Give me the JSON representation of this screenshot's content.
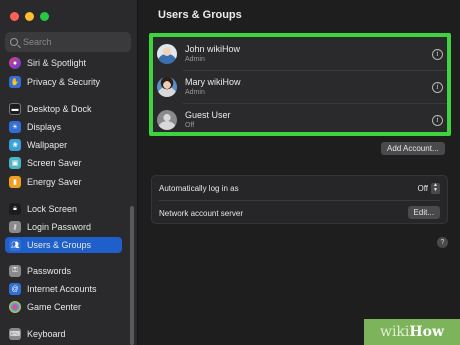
{
  "window": {
    "traffic_colors": [
      "#ff5f57",
      "#febc2e",
      "#28c840"
    ]
  },
  "search": {
    "placeholder": "Search"
  },
  "sidebar": {
    "items": [
      {
        "label": "Siri & Spotlight",
        "icon": "siri-icon",
        "color": "#8e44ad"
      },
      {
        "label": "Privacy & Security",
        "icon": "hand-icon",
        "color": "#2f6fd6"
      },
      {
        "label": "Desktop & Dock",
        "icon": "dock-icon",
        "color": "#1c1c1e"
      },
      {
        "label": "Displays",
        "icon": "sun-icon",
        "color": "#2f6fd6"
      },
      {
        "label": "Wallpaper",
        "icon": "wallpaper-icon",
        "color": "#3aa0d8"
      },
      {
        "label": "Screen Saver",
        "icon": "screen-saver-icon",
        "color": "#4cb6c9"
      },
      {
        "label": "Energy Saver",
        "icon": "battery-icon",
        "color": "#f0a020"
      },
      {
        "label": "Lock Screen",
        "icon": "lock-icon",
        "color": "#1c1c1e"
      },
      {
        "label": "Login Password",
        "icon": "key-icon",
        "color": "#8a8a8c"
      },
      {
        "label": "Users & Groups",
        "icon": "users-icon",
        "color": "#2f6fd6",
        "active": true
      },
      {
        "label": "Passwords",
        "icon": "passwords-icon",
        "color": "#8a8a8c"
      },
      {
        "label": "Internet Accounts",
        "icon": "at-icon",
        "color": "#2f6fd6"
      },
      {
        "label": "Game Center",
        "icon": "game-center-icon",
        "color": "#444"
      },
      {
        "label": "Keyboard",
        "icon": "keyboard-icon",
        "color": "#8a8a8c"
      }
    ]
  },
  "main": {
    "title": "Users & Groups",
    "users": [
      {
        "name": "John wikiHow",
        "role": "Admin"
      },
      {
        "name": "Mary wikiHow",
        "role": "Admin"
      },
      {
        "name": "Guest User",
        "role": "Off"
      }
    ],
    "add_account_label": "Add Account...",
    "auto_login_label": "Automatically log in as",
    "auto_login_value": "Off",
    "network_server_label": "Network account server",
    "edit_label": "Edit...",
    "help_label": "?"
  },
  "watermark": {
    "prefix": "wiki",
    "suffix": "How"
  }
}
